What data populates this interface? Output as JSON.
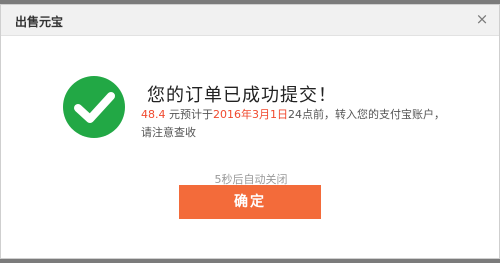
{
  "dialog": {
    "title": "出售元宝",
    "close_glyph": "×"
  },
  "message": {
    "title": "您的订单已成功提交！",
    "amount": "48.4",
    "text_1": " 元预计于",
    "date": "2016年3月1日",
    "text_2": "24点前，转入您的支付宝账户，请注意查收"
  },
  "countdown_text": "5秒后自动关闭",
  "confirm_label": "确定",
  "backdrop_fragment": "16",
  "icons": {
    "success": "check-circle-icon",
    "close": "close-icon"
  },
  "colors": {
    "success_green": "#22a845",
    "accent_red": "#f04a2f",
    "button_orange": "#f36b3a"
  }
}
